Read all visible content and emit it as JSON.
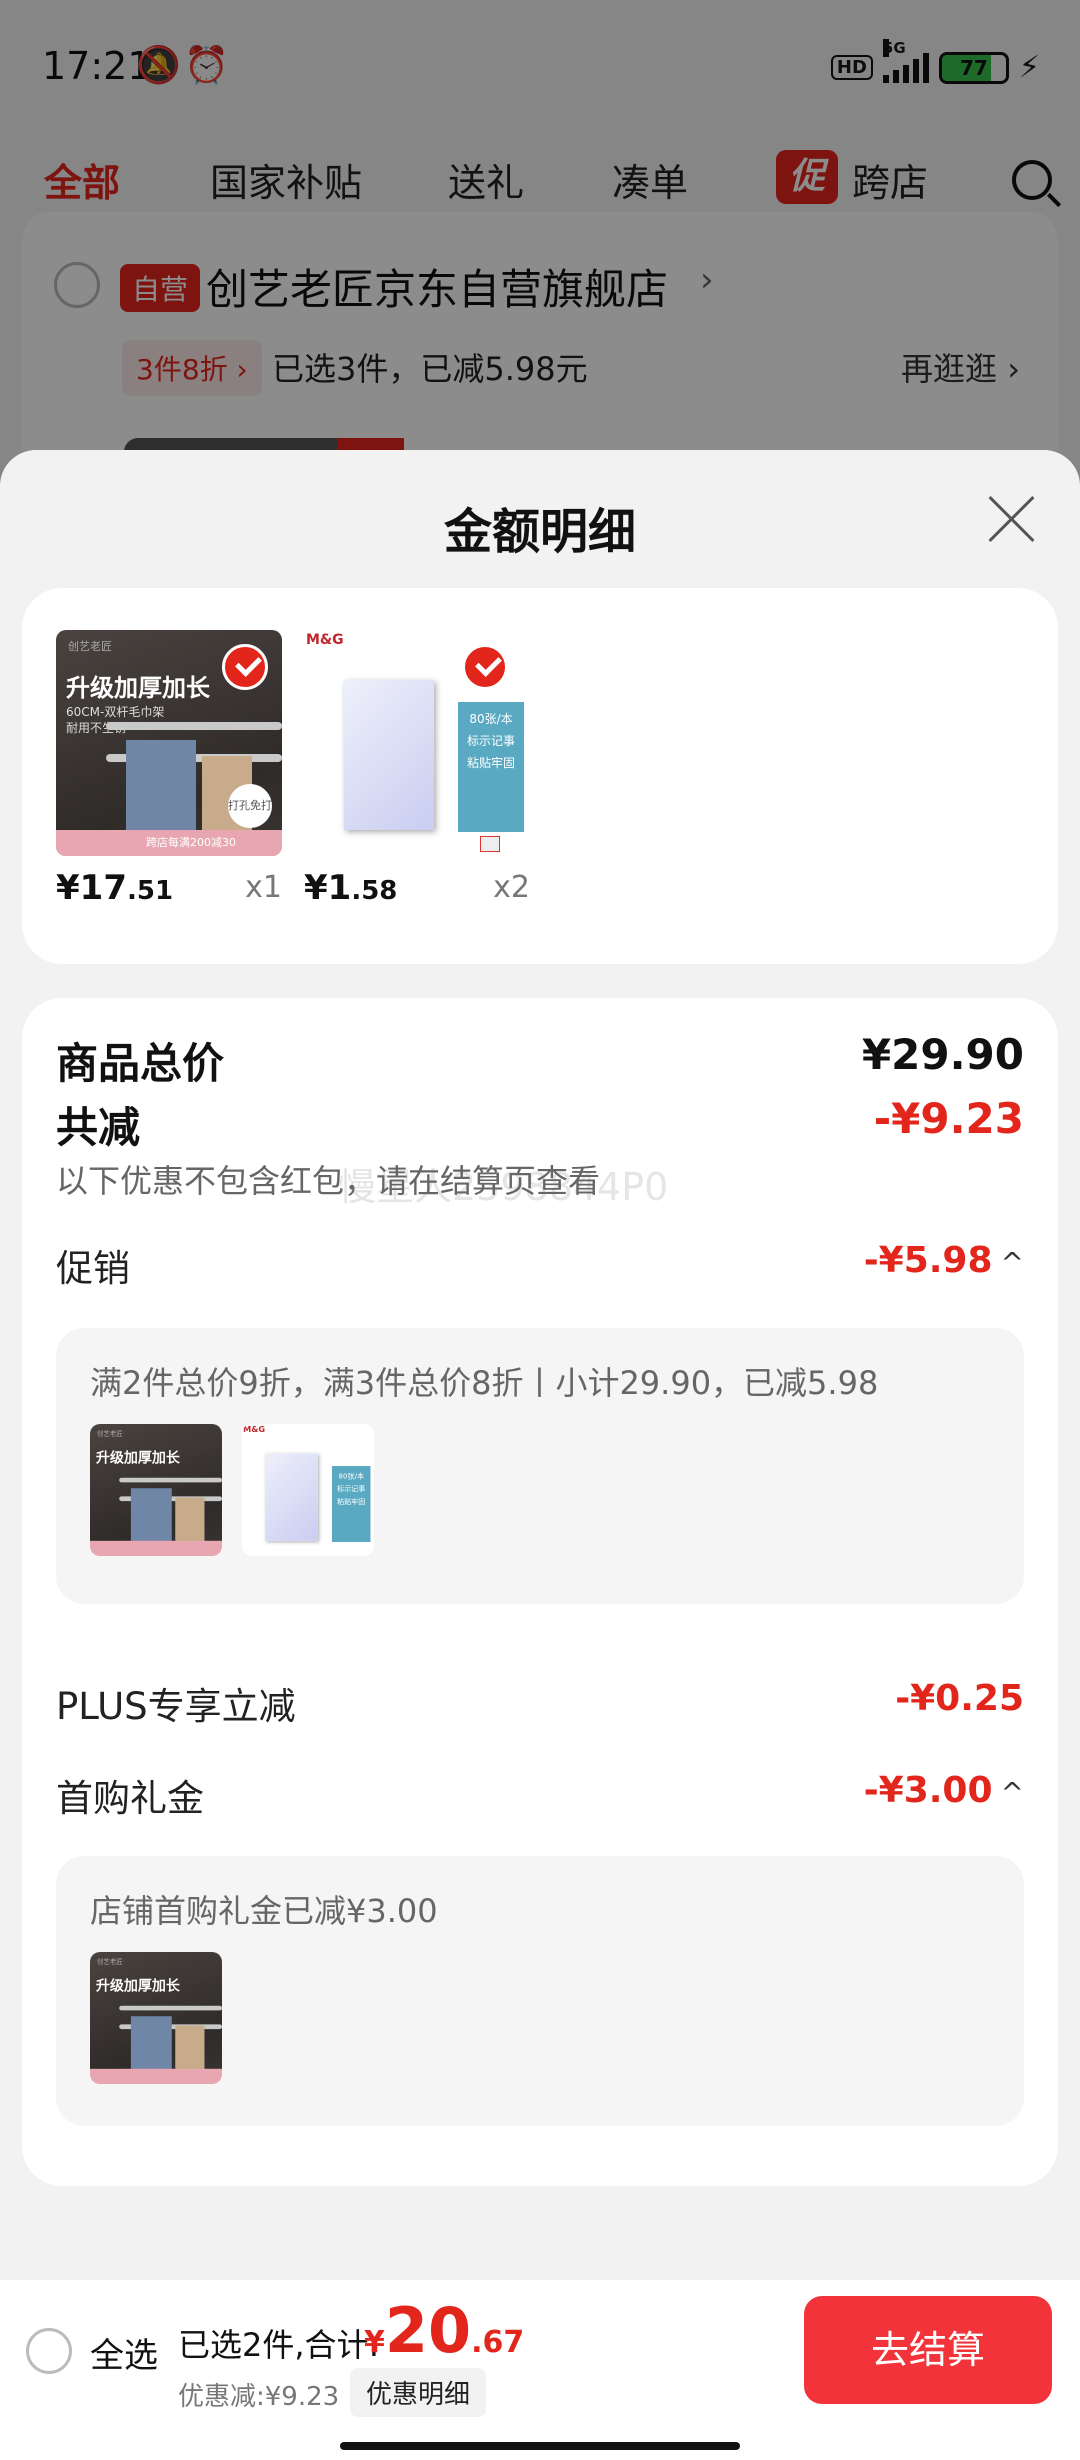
{
  "status_bar": {
    "time": "17:21",
    "network": "5G",
    "hd": "HD",
    "battery": "77",
    "battery_level": 0.77
  },
  "tabs": [
    "全部",
    "国家补贴",
    "送礼",
    "凑单",
    "跨店"
  ],
  "tabs_promo_badge": "促",
  "store": {
    "self_badge": "自营",
    "name": "创艺老匠京东自营旗舰店",
    "discount_tag": "3件8折 ›",
    "selected_summary": "已选3件，已减5.98元",
    "browse_more": "再逛逛 ›"
  },
  "sheet": {
    "title": "金额明细",
    "items": [
      {
        "price_int": "¥17",
        "price_dec": ".51",
        "qty": "x1",
        "thumb": {
          "headline": "升级加厚加长",
          "sub": "60CM-双杆毛巾架",
          "sub2": "耐用不生锈",
          "brand": "创艺老匠",
          "badge": "打孔免打孔",
          "footer": "跨店每满200减30"
        }
      },
      {
        "price_int": "¥1",
        "price_dec": ".58",
        "qty": "x2",
        "thumb": {
          "brand": "M&G",
          "label_lines": [
            "80张/本",
            "标示记事",
            "粘贴牢固"
          ]
        }
      }
    ],
    "summary": {
      "goods_total_label": "商品总价",
      "goods_total_value": "¥29.90",
      "total_reduce_label": "共减",
      "total_reduce_value": "-¥9.23",
      "watermark": "慢星人2598844P0",
      "note": "以下优惠不包含红包，请在结算页查看",
      "promo_label": "促销",
      "promo_value": "-¥5.98",
      "promo_detail": "满2件总价9折，满3件总价8折丨小计29.90，已减5.98",
      "plus_label": "PLUS专享立减",
      "plus_value": "-¥0.25",
      "first_label": "首购礼金",
      "first_value": "-¥3.00",
      "first_detail": "店铺首购礼金已减¥3.00"
    }
  },
  "bottom_bar": {
    "select_all": "全选",
    "selected_total": "已选2件,合计:",
    "total_currency": "¥",
    "total_int": "20",
    "total_dec": ".67",
    "discount": "优惠减:¥9.23",
    "detail_chip": "优惠明细",
    "checkout": "去结算"
  },
  "colors": {
    "accent": "#e3261c",
    "checkout": "#f2333a"
  },
  "icons": [
    "mute-bell-icon",
    "alarm-icon",
    "search-icon",
    "close-icon",
    "check-icon",
    "chevron-up-icon",
    "chevron-right-icon",
    "bolt-icon"
  ]
}
